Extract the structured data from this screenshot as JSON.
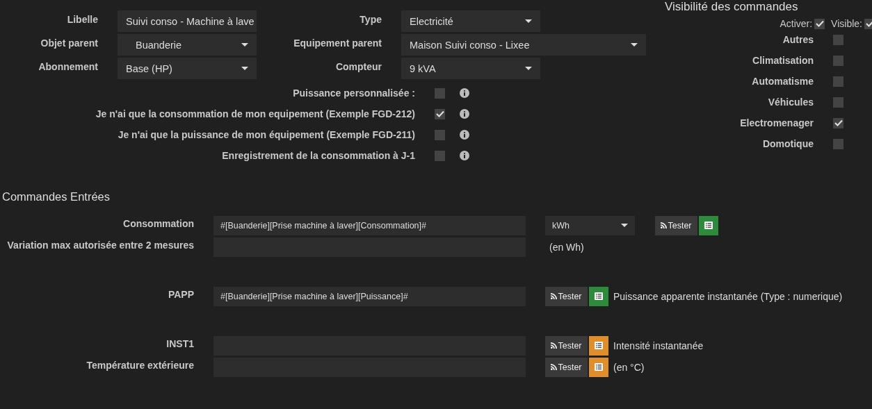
{
  "general": {
    "fields": [
      {
        "label": "Libelle",
        "kind": "input",
        "value": "Suivi conso - Machine à lave"
      },
      {
        "label": "Type",
        "kind": "select",
        "value": "Electricité"
      },
      {
        "label": "Objet parent",
        "kind": "select",
        "value": "Buanderie"
      },
      {
        "label": "Equipement parent",
        "kind": "select",
        "value": "Maison Suivi conso - Lixee",
        "wide": true
      },
      {
        "label": "Abonnement",
        "kind": "select",
        "value": "Base (HP)"
      },
      {
        "label": "Compteur",
        "kind": "select",
        "value": "9 kVA"
      }
    ],
    "options": [
      {
        "label": "Puissance personnalisée :",
        "checked": false
      },
      {
        "label": "Je n'ai que la consommation de mon equipement (Exemple FGD-212)",
        "checked": true
      },
      {
        "label": "Je n'ai que la puissance de mon équipement (Exemple FGD-211)",
        "checked": false
      },
      {
        "label": "Enregistrement de la consommation à J-1",
        "checked": false
      }
    ]
  },
  "visibility": {
    "title": "Visibilité des commandes",
    "activer_label": "Activer:",
    "activer_checked": true,
    "visible_label": "Visible:",
    "visible_checked": true,
    "categories": [
      {
        "label": "Autres",
        "checked": false
      },
      {
        "label": "Climatisation",
        "checked": false
      },
      {
        "label": "Automatisme",
        "checked": false
      },
      {
        "label": "Véhicules",
        "checked": false
      },
      {
        "label": "Electromenager",
        "checked": true
      },
      {
        "label": "Domotique",
        "checked": false
      }
    ]
  },
  "commands": {
    "title": "Commandes Entrées",
    "groups": [
      {
        "rows": [
          {
            "label": "Consommation",
            "value": "#[Buanderie][Prise machine à laver][Consommation]#",
            "unit": "kWh",
            "tester": "Tester",
            "color": "#2e8b3c"
          },
          {
            "label": "Variation max autorisée entre 2 mesures",
            "value": "",
            "note": "(en Wh)"
          }
        ]
      },
      {
        "rows": [
          {
            "label": "PAPP",
            "value": "#[Buanderie][Prise machine à laver][Puissance]#",
            "tester": "Tester",
            "color": "#2e8b3c",
            "note": "Puissance apparente instantanée (Type : numerique)"
          }
        ]
      },
      {
        "rows": [
          {
            "label": "INST1",
            "value": "",
            "tester": "Tester",
            "color": "#e08e2b",
            "note": "Intensité instantanée"
          },
          {
            "label": "Température extérieure",
            "value": "",
            "tester": "Tester",
            "color": "#e08e2b",
            "note": "(en °C)"
          }
        ]
      }
    ]
  }
}
